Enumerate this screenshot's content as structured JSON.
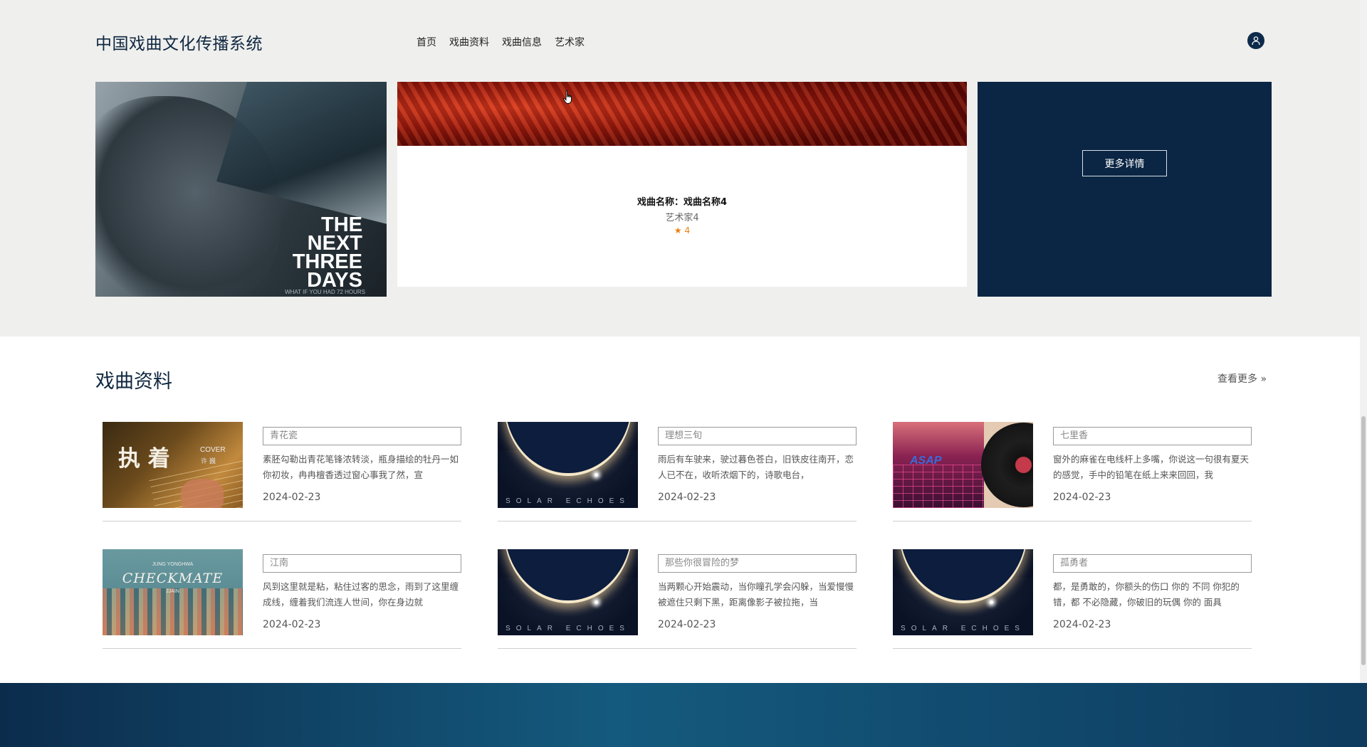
{
  "header": {
    "site_title": "中国戏曲文化传播系统",
    "nav": [
      "首页",
      "戏曲资料",
      "戏曲信息",
      "艺术家"
    ]
  },
  "icons": {
    "user": "user-icon",
    "more": "chevron-double-right-icon",
    "cursor": "hand-cursor-icon"
  },
  "poster": {
    "title_lines": [
      "THE",
      "NEXT",
      "THREE",
      "DAYS"
    ],
    "tagline": "WHAT IF YOU HAD 72 HOURS"
  },
  "feature": {
    "name": "戏曲名称：戏曲名称4",
    "artist": "艺术家4",
    "rating": "★ 4"
  },
  "detail_button": "更多详情",
  "section": {
    "title": "戏曲资料",
    "view_more": "查看更多"
  },
  "items": [
    {
      "title": "青花瓷",
      "desc": "素胚勾勒出青花笔锋浓转淡，瓶身描绘的牡丹一如你初妆，冉冉檀香透过窗心事我了然，宣",
      "date": "2024-02-23",
      "thumb_text": [
        "执 着",
        "COVER",
        "许 巍"
      ]
    },
    {
      "title": "理想三旬",
      "desc": "雨后有车驶来，驶过暮色苍白，旧铁皮往南开，恋人已不在，收听浓烟下的，诗歌电台，",
      "date": "2024-02-23",
      "thumb_text": [
        "SOLAR ECHOES"
      ]
    },
    {
      "title": "七里香",
      "desc": "窗外的麻雀在电线杆上多嘴，你说这一句很有夏天的感觉，手中的铅笔在纸上来来回回，我",
      "date": "2024-02-23",
      "thumb_text": [
        "ASAP"
      ]
    },
    {
      "title": "江南",
      "desc": "风到这里就是粘，粘住过客的思念，雨到了这里缠成线，缠着我们流连人世间，你在身边就",
      "date": "2024-02-23",
      "thumb_text": [
        "JUNG YONGHWA",
        "CHECKMATE",
        "JJAIN"
      ]
    },
    {
      "title": "那些你很冒险的梦",
      "desc": "当两颗心开始震动，当你瞳孔学会闪躲，当爱慢慢被遮住只剩下黑，距离像影子被拉拖，当",
      "date": "2024-02-23",
      "thumb_text": [
        "SOLAR ECHOES"
      ]
    },
    {
      "title": "孤勇者",
      "desc": "都，是勇敢的，你额头的伤口 你的 不同 你犯的错，都 不必隐藏，你破旧的玩偶 你的 面具",
      "date": "2024-02-23",
      "thumb_text": [
        "SOLAR ECHOES"
      ]
    }
  ],
  "colors": {
    "navy": "#0b2644",
    "top_bg": "#efefed",
    "rating": "#e8820c"
  }
}
